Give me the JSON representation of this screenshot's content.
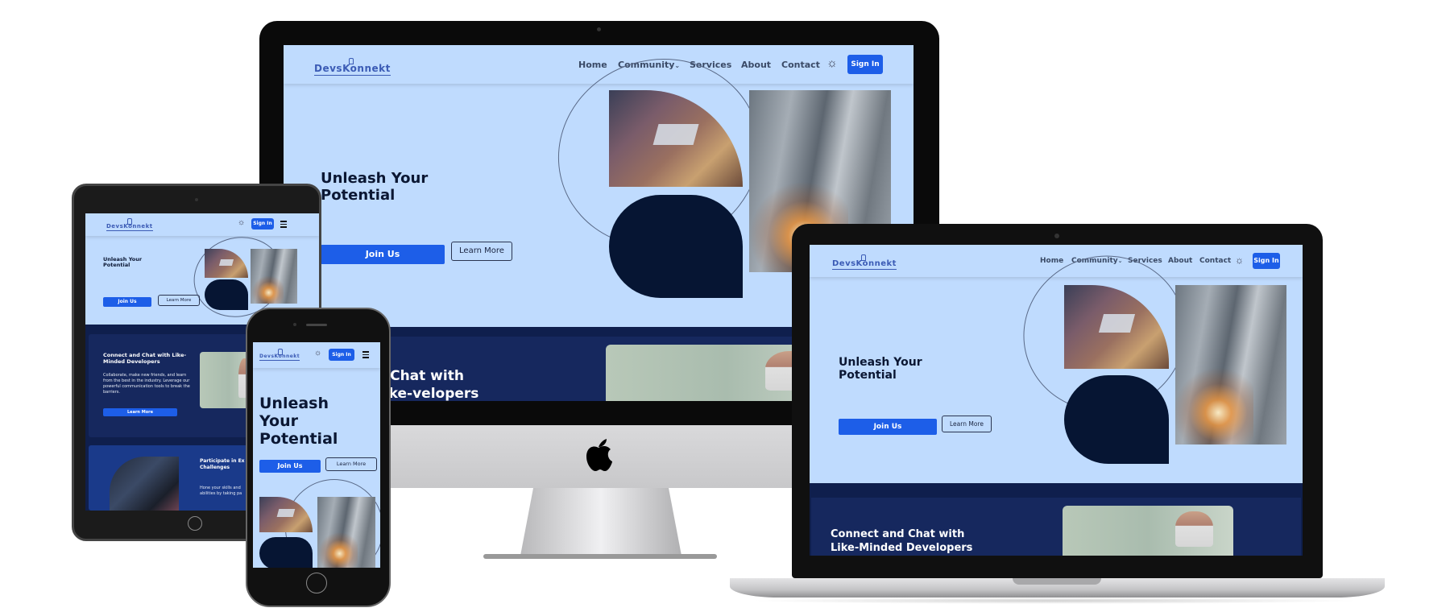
{
  "site": {
    "logo": "DevsKonnekt",
    "nav": {
      "home": "Home",
      "community": "Community",
      "community_caret": "⌄",
      "services": "Services",
      "about": "About",
      "contact": "Contact",
      "theme_icon": "☼",
      "sign_in": "Sign In"
    },
    "hero": {
      "title": "Unleash Your Potential",
      "join": "Join Us",
      "learn": "Learn More"
    },
    "section_connect": {
      "title": "Connect and Chat with Like-Minded Developers",
      "text": "Collaborate, make new friends, and learn from the best in the industry. Leverage our powerful communication tools to break the barriers.",
      "cta": "Learn More"
    },
    "section_challenges": {
      "title": "Participate in Exciting Challenges",
      "text": "Hone your skills and test your abilities by taking part in coding competitions."
    }
  },
  "imac": {
    "partial_section_title": "d Chat with Like-velopers"
  },
  "laptop": {
    "section_title": "Connect and Chat with Like-Minded Developers"
  },
  "tablet": {
    "challenge_title_partial": "Participate in Ex Challenges",
    "challenge_text_partial": "Hone your skills and abilities by taking pa"
  },
  "colors": {
    "brand_blue": "#1d5ee8",
    "hero_bg": "#bfdbfe",
    "dark_navy": "#16285e",
    "blob": "#061533"
  }
}
